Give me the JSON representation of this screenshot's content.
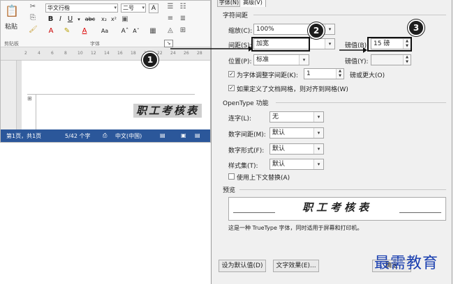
{
  "word": {
    "clipboard_paste": "粘贴",
    "font_name": "华文行楷",
    "font_size": "二号",
    "group_clipboard": "剪贴板",
    "group_font": "字体",
    "ruler_ticks": [
      "2",
      "4",
      "6",
      "8",
      "10",
      "12",
      "14",
      "16",
      "18",
      "20",
      "22",
      "24",
      "26",
      "28"
    ],
    "doc_text": "职工考核表",
    "status": {
      "page": "第1页，共1页",
      "words": "5/42 个字",
      "lang": "中文(中国)"
    }
  },
  "dialog": {
    "tabs": [
      "字体(N)",
      "高级(V)"
    ],
    "spacing_section": "字符间距",
    "scale_label": "缩放(C):",
    "scale_value": "100%",
    "spacing_label": "间距(S):",
    "spacing_value": "加宽",
    "spacing_by_label": "磅值(B):",
    "spacing_by_value": "15 磅",
    "position_label": "位置(P):",
    "position_value": "标准",
    "position_by_label": "磅值(Y):",
    "kerning_label": "为字体调整字间距(K):",
    "kerning_value": "1",
    "kerning_suffix": "磅或更大(O)",
    "snap_grid_label": "如果定义了文档网格，则对齐到网格(W)",
    "opentype_section": "OpenType 功能",
    "ligatures_label": "连字(L):",
    "ligatures_value": "无",
    "num_spacing_label": "数字间距(M):",
    "num_spacing_value": "默认",
    "num_forms_label": "数字形式(F):",
    "num_forms_value": "默认",
    "stylistic_label": "样式集(T):",
    "stylistic_value": "默认",
    "contextual_label": "使用上下文替换(A)",
    "preview_section": "预览",
    "preview_text": "职工考核表",
    "preview_note": "这是一种 TrueType 字体，同时适用于屏幕和打印机。",
    "set_default_button": "设为默认值(D)",
    "text_effects_button": "文字效果(E)...",
    "ok_button": "确定"
  },
  "callouts": [
    "1",
    "2",
    "3"
  ],
  "watermark": "最需教育",
  "colors": {
    "status_bar": "#2b579a",
    "watermark": "#1a3fb0",
    "callout": "#1d1d1d"
  }
}
